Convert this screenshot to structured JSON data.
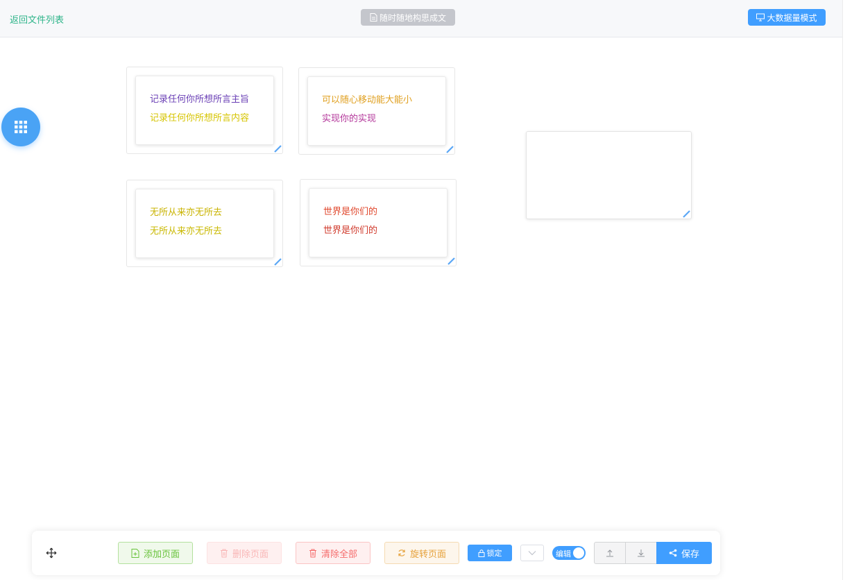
{
  "header": {
    "back_label": "返回文件列表",
    "compose_label": "随时随地构思成文",
    "bigdata_label": "大数据量模式"
  },
  "fab": {
    "icon": "grid-icon",
    "color": "#4aa3f5"
  },
  "notes": [
    {
      "line1": "记录任何你所想所言主旨",
      "line1_color": "#6a3fb5",
      "line2": "记录任何你所想所言内容",
      "line2_color": "#d6c400"
    },
    {
      "line1": "可以随心移动能大能小",
      "line1_color": "#e0a020",
      "line2": "实现你的实现",
      "line2_color": "#b3369a"
    },
    {
      "line1": "无所从来亦无所去",
      "line1_color": "#c9b300",
      "line2": "无所从来亦无所去",
      "line2_color": "#c9b800"
    },
    {
      "line1": "世界是你们的",
      "line1_color": "#e0472c",
      "line2": "世界是你们的",
      "line2_color": "#d0392b"
    }
  ],
  "toolbar": {
    "add_label": "添加页面",
    "delete_label": "删除页面",
    "clear_label": "清除全部",
    "rotate_label": "旋转页面",
    "lock_label": "锁定",
    "edit_label": "编辑",
    "edit_on": true,
    "save_label": "保存"
  },
  "colors": {
    "primary": "#409eff",
    "success": "#67c23a",
    "danger": "#f56c6c",
    "warning": "#e6a23c",
    "back_link": "#2fb58a"
  }
}
